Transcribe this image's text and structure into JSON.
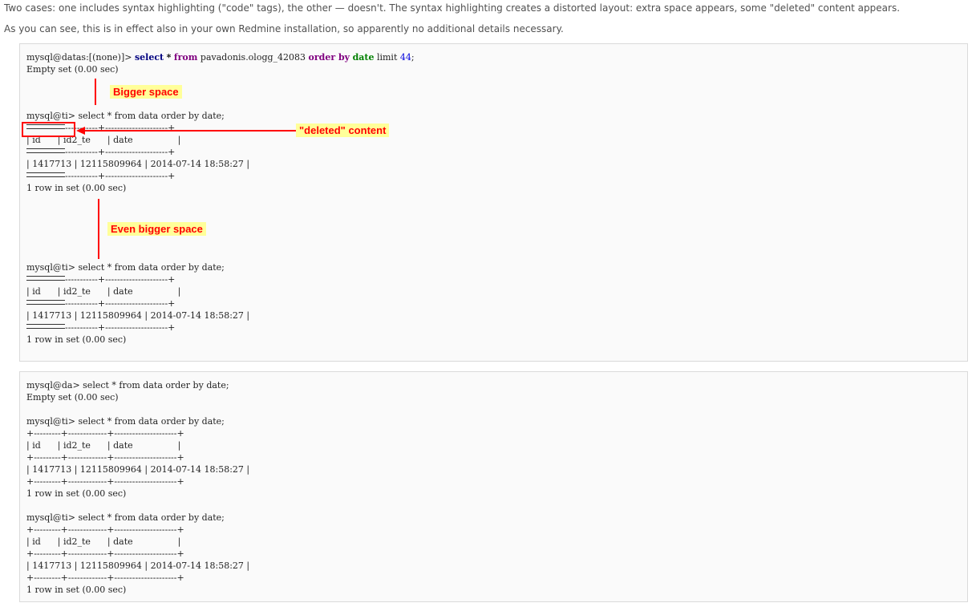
{
  "intro": {
    "para1": "Two cases: one includes syntax highlighting (\"code\" tags), the other — doesn't. The syntax highlighting creates a distorted layout: extra space appears, some \"deleted\" content appears.",
    "para2": "As you can see, this is in effect also in your own Redmine installation, so apparently no additional details necessary."
  },
  "highlighted_block": {
    "first_prompt": "mysql@datas:[(none)]>",
    "kw_select": "select",
    "kw_star": "*",
    "kw_from": "from",
    "table_name": "pavadonis.ologg_42083",
    "kw_order_by": "order by",
    "kw_date": "date",
    "kw_limit": "limit",
    "limit_value": "44",
    "empty_set": "Empty set (0.00 sec)",
    "query1": "mysql@ti> select * from data order by date;",
    "border_rest": "-----------+---------------------+",
    "header_row": "| id      | id2_te      | date                |",
    "data_row": "| 1417713 | 12115809964 | 2014-07-14 18:58:27 |",
    "row_count": "1 row in set (0.00 sec)",
    "query2": "mysql@ti> select * from data order by date;"
  },
  "plain_block": {
    "q1": "mysql@da> select * from data order by date;",
    "empty_set": "Empty set (0.00 sec)",
    "q2": "mysql@ti> select * from data order by date;",
    "border": "+---------+-------------+---------------------+",
    "header_row": "| id      | id2_te      | date                |",
    "data_row": "| 1417713 | 12115809964 | 2014-07-14 18:58:27 |",
    "row_count": "1 row in set (0.00 sec)",
    "q3": "mysql@ti> select * from data order by date;"
  },
  "annotations": {
    "bigger_space": "Bigger space",
    "deleted_content": "\"deleted\" content",
    "even_bigger_space": "Even bigger space",
    "color": "#ff0000",
    "highlight_bg": "#ffff99"
  }
}
